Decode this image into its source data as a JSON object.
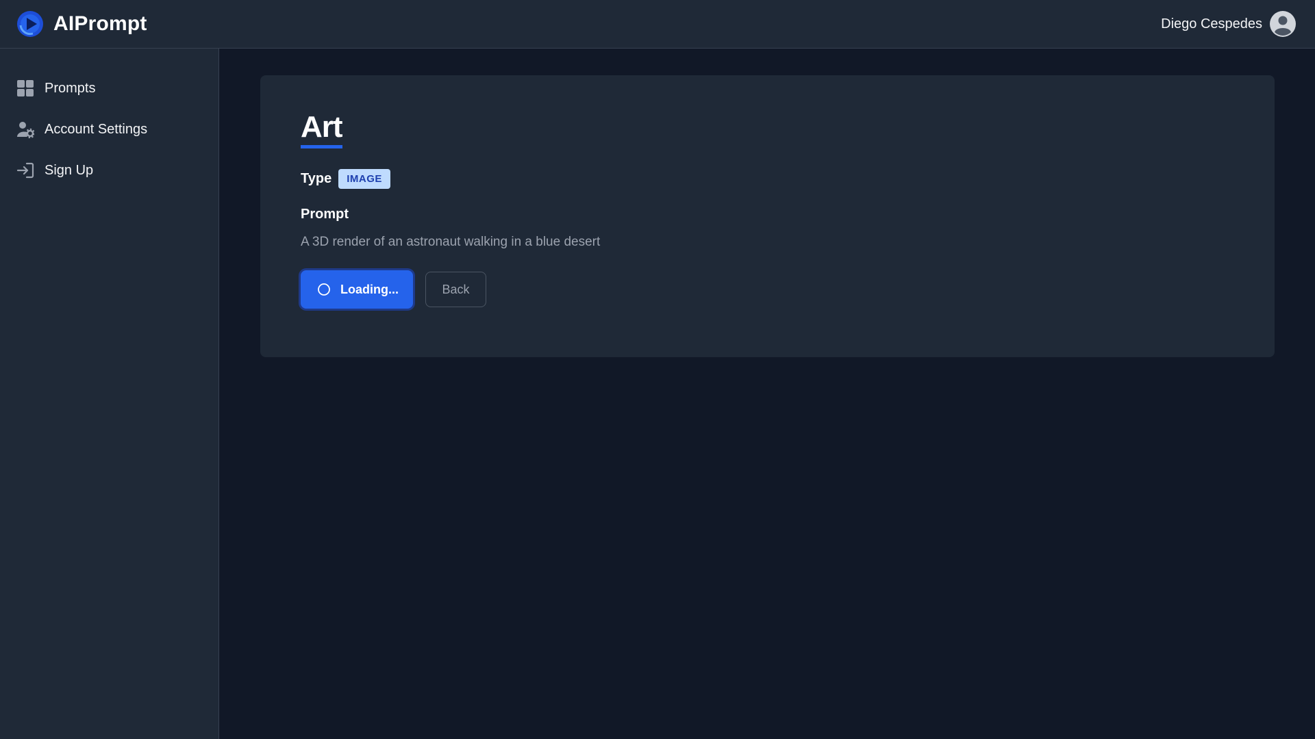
{
  "app": {
    "name": "AIPrompt",
    "brand_color": "#2563eb",
    "logo_icon": "play-logo-icon"
  },
  "user": {
    "name": "Diego Cespedes",
    "avatar_icon": "user-avatar-icon"
  },
  "sidebar": {
    "items": [
      {
        "label": "Prompts",
        "icon": "grid-icon"
      },
      {
        "label": "Account Settings",
        "icon": "user-gear-icon"
      },
      {
        "label": "Sign Up",
        "icon": "sign-in-icon"
      }
    ]
  },
  "prompt_detail": {
    "title": "Art",
    "type_label": "Type",
    "type_value": "IMAGE",
    "prompt_label": "Prompt",
    "prompt_text": "A 3D render of an astronaut walking in a blue desert"
  },
  "actions": {
    "primary_label": "Loading...",
    "primary_icon": "spinner-icon",
    "back_label": "Back"
  }
}
